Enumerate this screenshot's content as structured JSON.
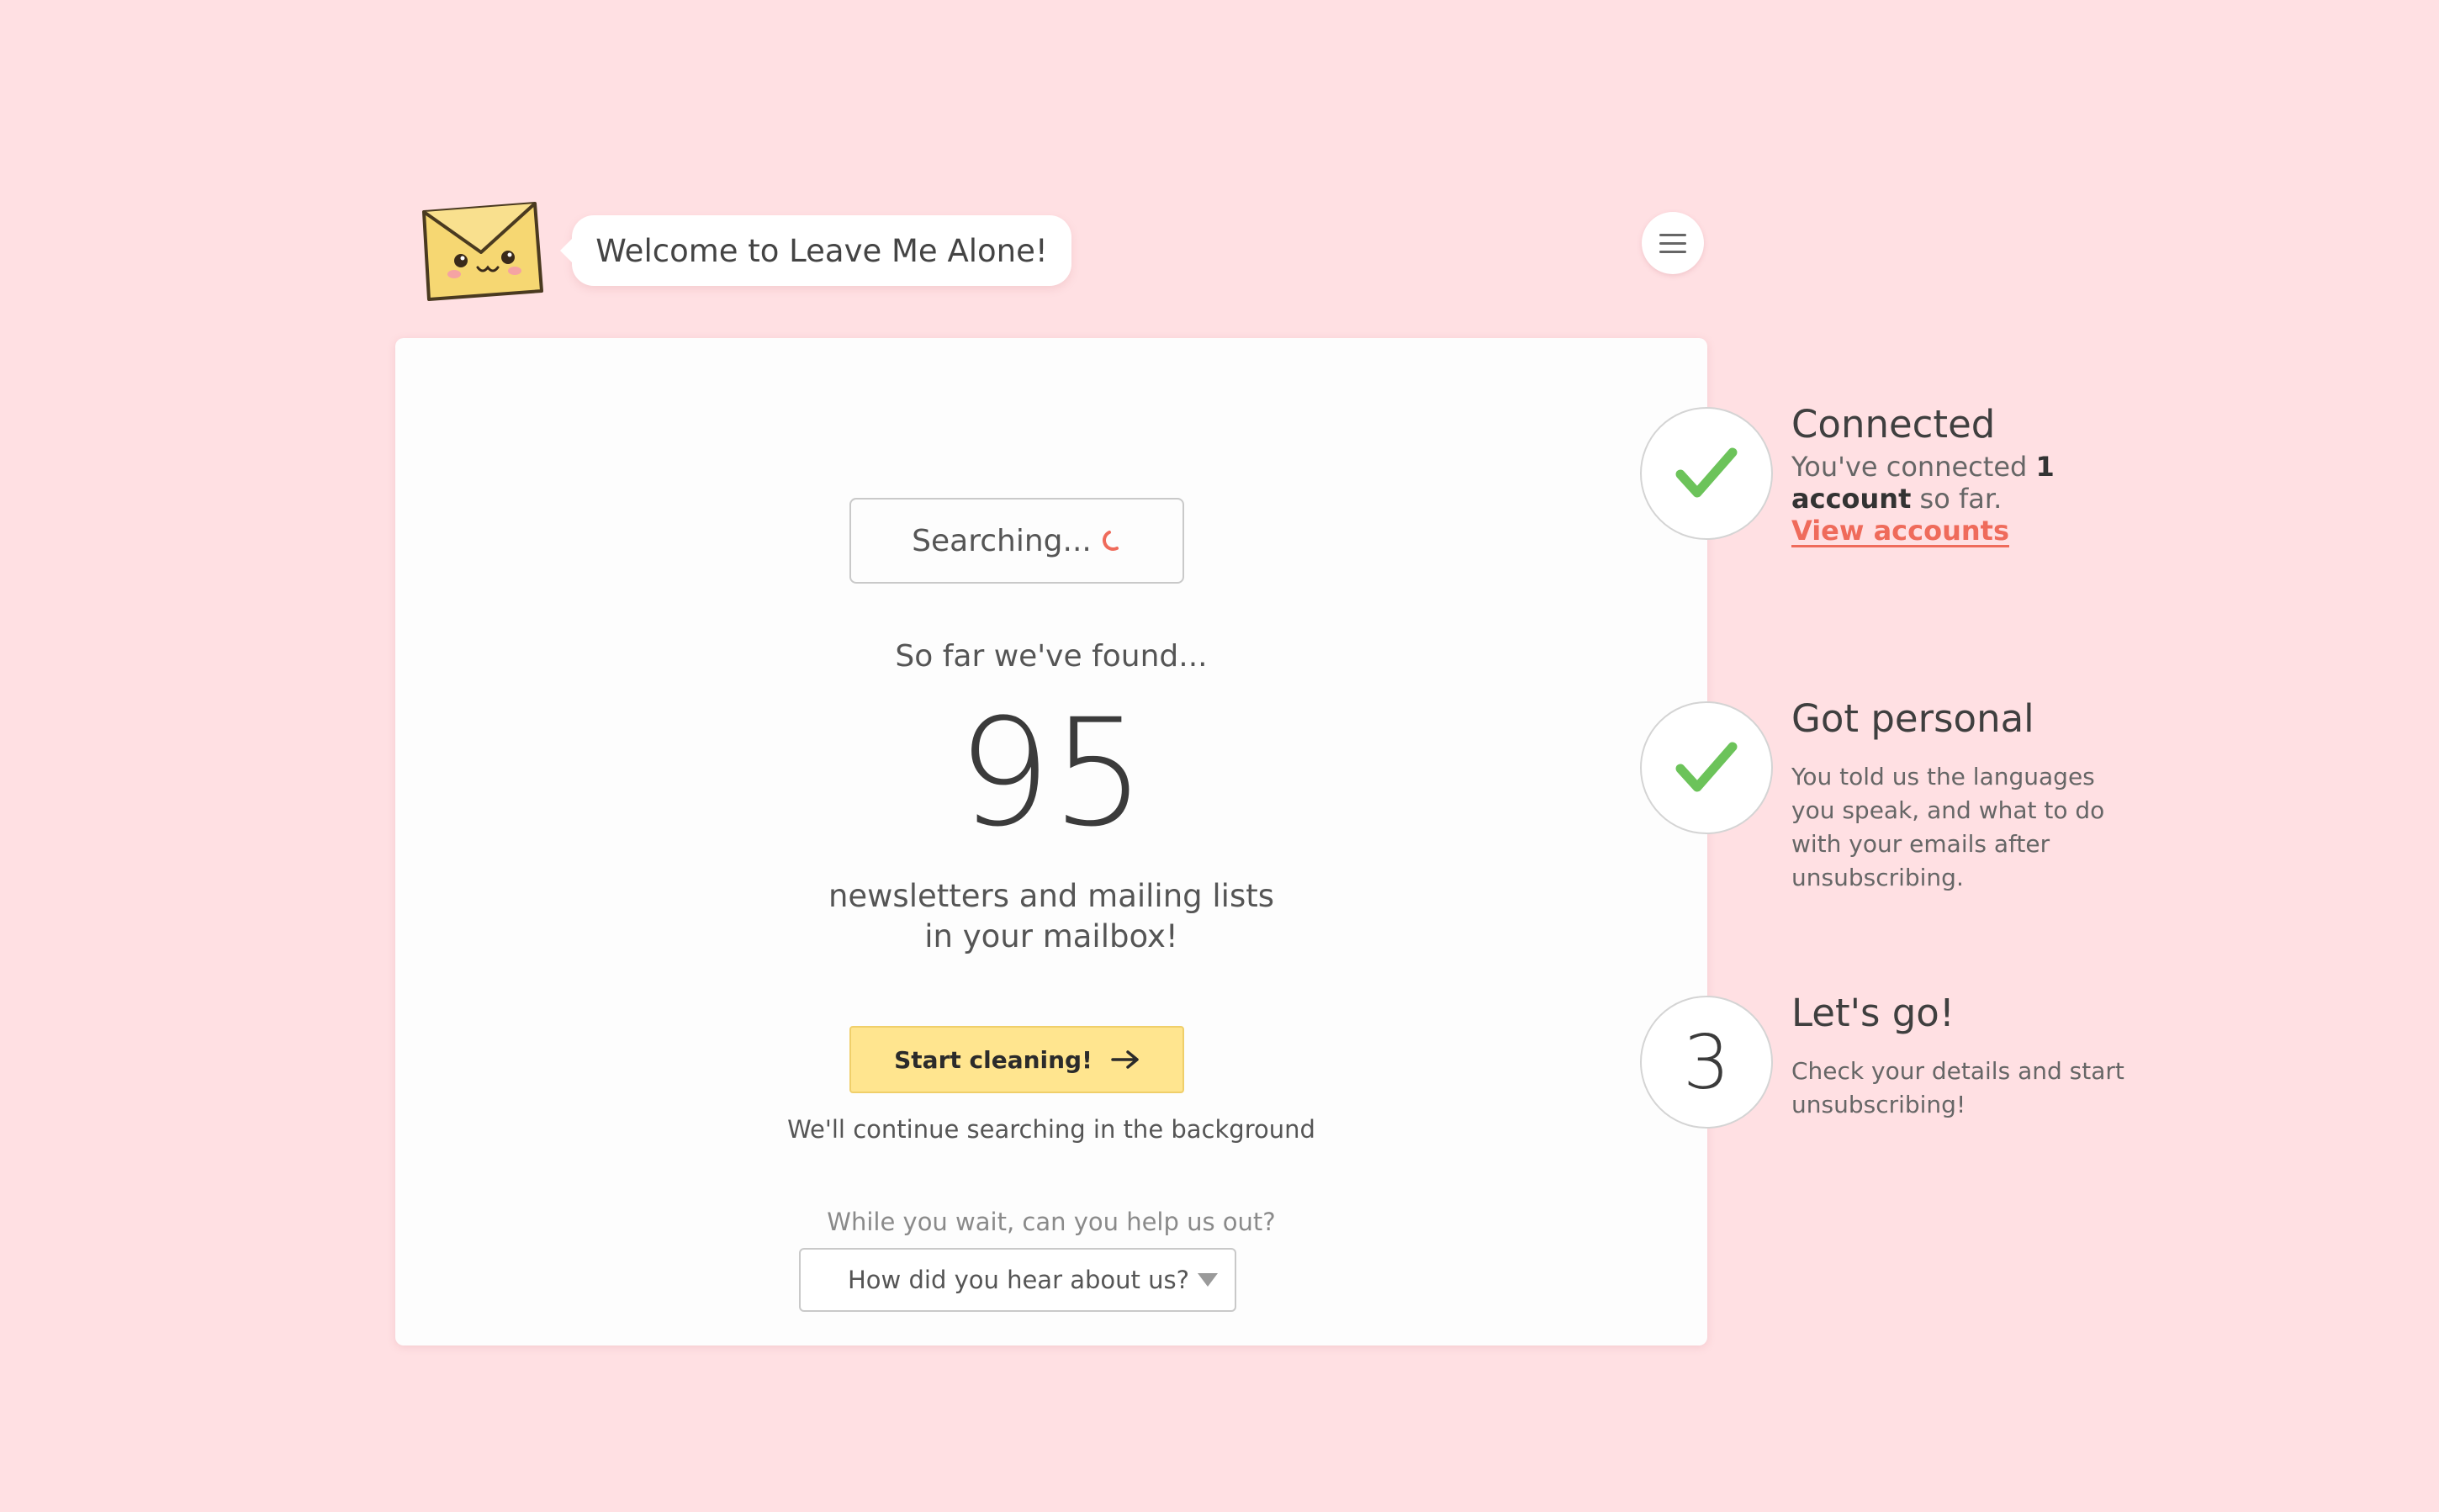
{
  "header": {
    "welcome_text": "Welcome to Leave Me Alone!",
    "mascot_icon": "envelope-mascot-icon",
    "menu_icon": "hamburger-menu-icon"
  },
  "search": {
    "status_label": "Searching...",
    "found_intro": "So far we've found...",
    "count": "95",
    "desc_line1": "newsletters and mailing lists",
    "desc_line2": "in your mailbox!",
    "cta_label": "Start cleaning!",
    "cta_note": "We'll continue searching in the background",
    "survey_prompt": "While you wait, can you help us out?",
    "survey_select_value": "How did you hear about us?"
  },
  "steps": [
    {
      "icon": "checkmark-icon",
      "title": "Connected",
      "text_prefix": "You've connected ",
      "text_bold_num": "1",
      "text_bold_word": "account",
      "text_suffix": " so far.",
      "link": "View accounts"
    },
    {
      "icon": "checkmark-icon",
      "title": "Got personal",
      "lines": [
        "You told us the languages",
        "you speak, and what to do",
        "with your emails after",
        "unsubscribing."
      ]
    },
    {
      "number": "3",
      "title": "Let's go!",
      "lines": [
        "Check your details and start",
        "unsubscribing!"
      ]
    }
  ],
  "colors": {
    "background": "#ffe0e3",
    "card": "#fdfdfd",
    "cta": "#ffe58f",
    "check": "#6cc35a",
    "link": "#ef6b5b"
  }
}
